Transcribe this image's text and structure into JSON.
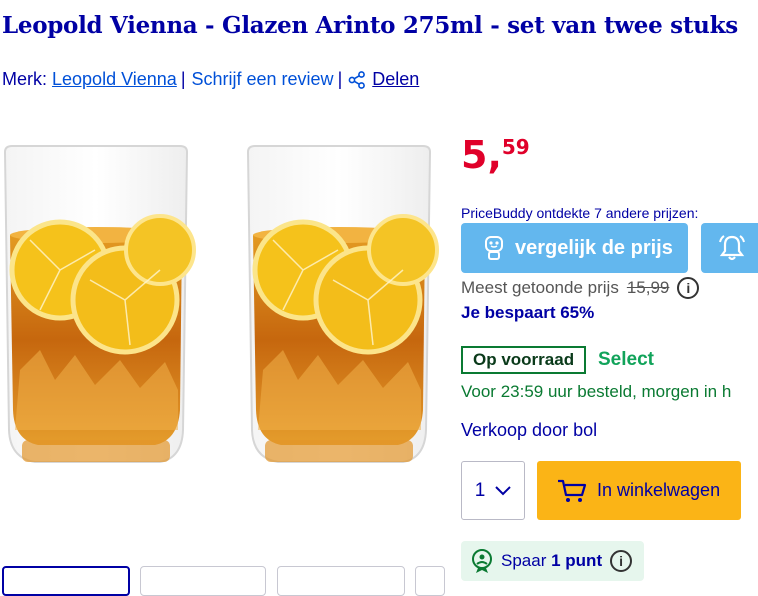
{
  "product": {
    "title": "Leopold Vienna - Glazen Arinto 275ml - set van twee stuks"
  },
  "meta": {
    "brand_prefix": "Merk:",
    "brand": "Leopold Vienna",
    "separator": "|",
    "review": "Schrijf een review",
    "share": "Delen"
  },
  "price": {
    "euros": "5,",
    "cents": "59"
  },
  "pricebuddy": {
    "text": "PriceBuddy ontdekte 7 andere prijzen:",
    "compare": "vergelijk de prijs"
  },
  "shown_price": {
    "label": "Meest getoonde prijs",
    "old": "15,99"
  },
  "savings": "Je bespaart 65%",
  "stock": {
    "label": "Op voorraad",
    "select": "Select"
  },
  "delivery": "Voor 23:59 uur besteld, morgen in h",
  "seller": "Verkoop door bol",
  "quantity": "1",
  "cart": {
    "label": "In winkelwagen"
  },
  "points": {
    "prefix": "Spaar",
    "value": "1 punt"
  },
  "icons": {
    "share": "share-icon",
    "pricebuddy": "pricebuddy-icon",
    "bell": "bell-icon",
    "info": "info-icon",
    "chevron": "chevron-down-icon",
    "cart": "cart-icon",
    "points": "points-icon"
  },
  "colors": {
    "text": "#0000a4",
    "price": "#e0002a",
    "compare_bg": "#63b7ee",
    "cart_bg": "#fbb416",
    "stock": "#0a7a32",
    "select": "#11a35a"
  }
}
